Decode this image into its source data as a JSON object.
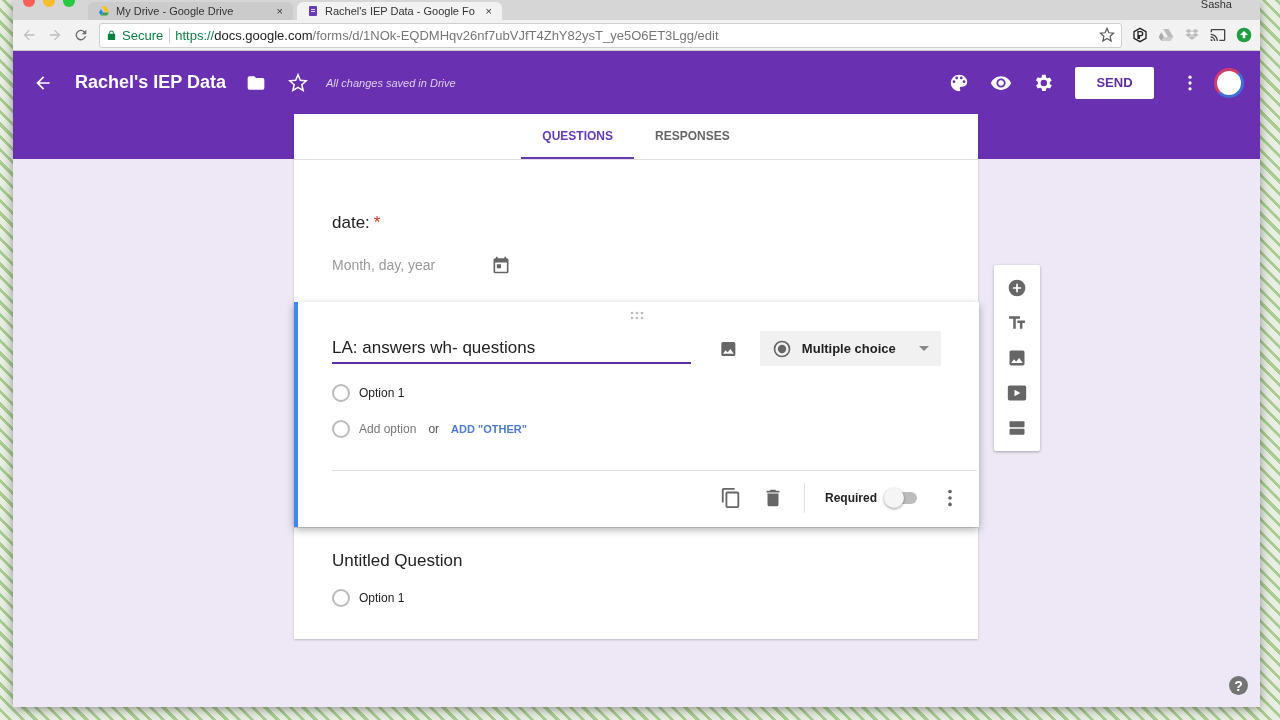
{
  "browser": {
    "tabs": [
      {
        "title": "My Drive - Google Drive",
        "kind": "drive",
        "close": "×",
        "selected": false
      },
      {
        "title": "Rachel's IEP Data - Google Fo",
        "kind": "forms",
        "close": "×",
        "selected": true
      }
    ],
    "user": "Sasha",
    "address": {
      "security": "Secure",
      "scheme": "https://",
      "host": "docs.google.com",
      "path": "/forms/d/1NOk-EQDMHqv26nf7ubVJfT4ZhY82ysT_ye5O6ET3Lgg/edit"
    }
  },
  "header": {
    "title": "Rachel's IEP Data",
    "status": "All changes saved in Drive",
    "send": "SEND"
  },
  "tabs": [
    {
      "label": "QUESTIONS",
      "selected": true
    },
    {
      "label": "RESPONSES",
      "selected": false
    }
  ],
  "questions": [
    {
      "kind": "date",
      "title": "date:",
      "required_mark": "*",
      "placeholder": "Month, day, year"
    },
    {
      "kind": "choice",
      "editing": true,
      "title": "LA: answers wh- questions",
      "type": "Multiple choice",
      "options": [
        {
          "label": "Option 1",
          "selected": false
        }
      ],
      "add_option": "Add option",
      "or": "or",
      "add_other": "ADD \"OTHER\"",
      "required_label": "Required",
      "required": false
    },
    {
      "kind": "choice",
      "editing": false,
      "title": "Untitled Question",
      "options": [
        {
          "label": "Option 1",
          "selected": false
        }
      ]
    }
  ],
  "help": "?"
}
